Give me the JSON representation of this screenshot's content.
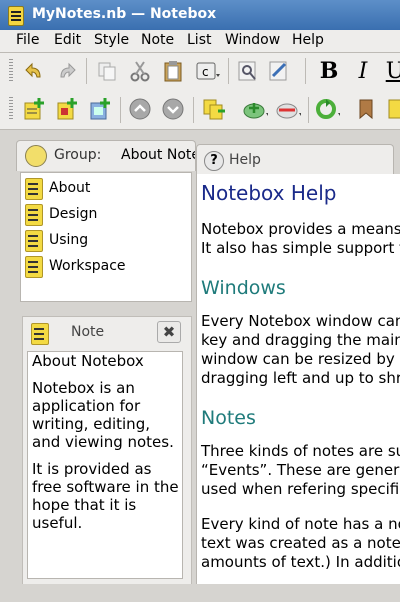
{
  "window": {
    "title": "MyNotes.nb — Notebox"
  },
  "menu": [
    "File",
    "Edit",
    "Style",
    "Note",
    "List",
    "Window",
    "Help"
  ],
  "toolbar": {
    "format_bold": "B",
    "format_italic": "I",
    "format_underline": "U"
  },
  "group": {
    "label": "Group:",
    "value": "About Notebox"
  },
  "notes_list": [
    "About",
    "Design",
    "Using",
    "Workspace"
  ],
  "note_panel": {
    "title": "Note",
    "close_label": "✖",
    "paragraphs": [
      "About Notebox",
      "Notebox is an application for writing, editing, and viewing notes.",
      "It is provided as free software in the hope that it is useful."
    ]
  },
  "help_panel": {
    "tab_label": "Help",
    "heading": "Notebox Help",
    "intro": [
      "Notebox provides a means",
      "It also has simple support f"
    ],
    "windows_heading": "Windows",
    "windows_text": [
      "Every Notebox window can",
      "key and dragging the main",
      "window can be resized by",
      "dragging left and up to shr"
    ],
    "notes_heading": "Notes",
    "notes_text_1": [
      "Three kinds of notes are su",
      "“Events”. These are generi",
      "used when refering specifi"
    ],
    "notes_text_2": [
      "Every kind of note has a no",
      "text was created as a note",
      "amounts of text.) In additio"
    ]
  },
  "colors": {
    "accent": "#1a2a8a",
    "section": "#1f7b7b",
    "note_yellow": "#f3da43"
  }
}
